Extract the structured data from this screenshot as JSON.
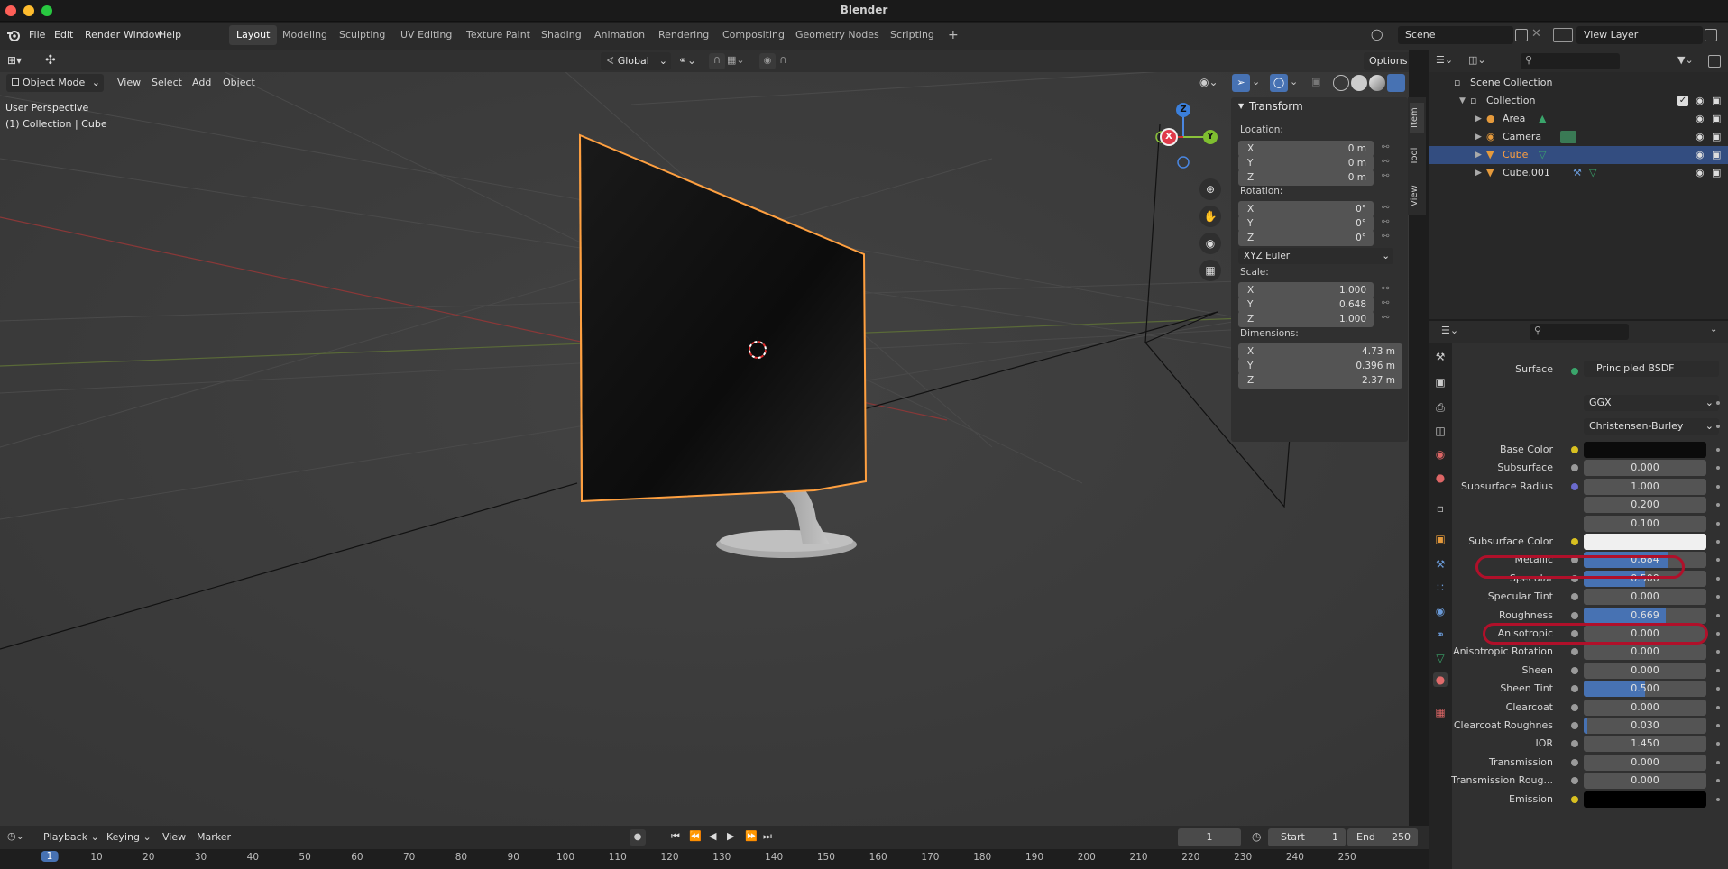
{
  "window": {
    "title": "Blender"
  },
  "menu": [
    "File",
    "Edit",
    "Render",
    "Window",
    "Help"
  ],
  "workspaces": [
    {
      "label": "Layout",
      "active": true
    },
    {
      "label": "Modeling"
    },
    {
      "label": "Sculpting"
    },
    {
      "label": "UV Editing"
    },
    {
      "label": "Texture Paint"
    },
    {
      "label": "Shading"
    },
    {
      "label": "Animation"
    },
    {
      "label": "Rendering"
    },
    {
      "label": "Compositing"
    },
    {
      "label": "Geometry Nodes"
    },
    {
      "label": "Scripting"
    }
  ],
  "add_workspace": "+",
  "scene": {
    "name": "Scene",
    "view_layer": "View Layer"
  },
  "viewport": {
    "transform_orientation": "Global",
    "options_label": "Options",
    "mode": "Object Mode",
    "menus": [
      "View",
      "Select",
      "Add",
      "Object"
    ],
    "overlay_text": {
      "perspective": "User Perspective",
      "context": "(1) Collection | Cube"
    },
    "gizmo": {
      "x": "X",
      "y": "Y",
      "z": "Z"
    }
  },
  "npanel": {
    "header": "Transform",
    "tabs": [
      "Item",
      "Tool",
      "View"
    ],
    "location_label": "Location:",
    "location": [
      {
        "axis": "X",
        "value": "0 m"
      },
      {
        "axis": "Y",
        "value": "0 m"
      },
      {
        "axis": "Z",
        "value": "0 m"
      }
    ],
    "rotation_label": "Rotation:",
    "rotation": [
      {
        "axis": "X",
        "value": "0°"
      },
      {
        "axis": "Y",
        "value": "0°"
      },
      {
        "axis": "Z",
        "value": "0°"
      }
    ],
    "rotation_mode": "XYZ Euler",
    "scale_label": "Scale:",
    "scale": [
      {
        "axis": "X",
        "value": "1.000"
      },
      {
        "axis": "Y",
        "value": "0.648"
      },
      {
        "axis": "Z",
        "value": "1.000"
      }
    ],
    "dimensions_label": "Dimensions:",
    "dimensions": [
      {
        "axis": "X",
        "value": "4.73 m"
      },
      {
        "axis": "Y",
        "value": "0.396 m"
      },
      {
        "axis": "Z",
        "value": "2.37 m"
      }
    ]
  },
  "outliner": {
    "rows": [
      {
        "label": "Scene Collection"
      },
      {
        "label": "Collection"
      },
      {
        "label": "Area"
      },
      {
        "label": "Camera"
      },
      {
        "label": "Cube",
        "selected": true
      },
      {
        "label": "Cube.001"
      }
    ]
  },
  "properties": {
    "surface_label": "Surface",
    "surface_value": "Principled BSDF",
    "distribution": "GGX",
    "subsurface_method": "Christensen-Burley",
    "rows": [
      {
        "label": "Base Color",
        "value": "",
        "dot": "#d8c020",
        "color": "#0b0b0b"
      },
      {
        "label": "Subsurface",
        "value": "0.000",
        "fill": 0
      },
      {
        "label": "Subsurface Radius",
        "value": "1.000",
        "fill": 0,
        "dot": "#6a6acc"
      },
      {
        "label": "",
        "value": "0.200",
        "fill": 0,
        "nodot": true
      },
      {
        "label": "",
        "value": "0.100",
        "fill": 0,
        "nodot": true
      },
      {
        "label": "Subsurface Color",
        "value": "",
        "dot": "#d8c020",
        "color": "#f0f0f0"
      },
      {
        "label": "Metallic",
        "value": "0.684",
        "fill": 0.684,
        "highlight": true
      },
      {
        "label": "Specular",
        "value": "0.500",
        "fill": 0.5
      },
      {
        "label": "Specular Tint",
        "value": "0.000",
        "fill": 0
      },
      {
        "label": "Roughness",
        "value": "0.669",
        "fill": 0.669,
        "highlight": true
      },
      {
        "label": "Anisotropic",
        "value": "0.000",
        "fill": 0
      },
      {
        "label": "Anisotropic Rotation",
        "value": "0.000",
        "fill": 0
      },
      {
        "label": "Sheen",
        "value": "0.000",
        "fill": 0
      },
      {
        "label": "Sheen Tint",
        "value": "0.500",
        "fill": 0.5
      },
      {
        "label": "Clearcoat",
        "value": "0.000",
        "fill": 0
      },
      {
        "label": "Clearcoat Roughnes",
        "value": "0.030",
        "fill": 0.03
      },
      {
        "label": "IOR",
        "value": "1.450",
        "fill": 0
      },
      {
        "label": "Transmission",
        "value": "0.000",
        "fill": 0
      },
      {
        "label": "Transmission Roug...",
        "value": "0.000",
        "fill": 0
      },
      {
        "label": "Emission",
        "value": "",
        "dot": "#d8c020",
        "color": "#000000"
      }
    ]
  },
  "timeline": {
    "menus": [
      "Playback",
      "Keying",
      "View",
      "Marker"
    ],
    "current_frame": "1",
    "start_label": "Start",
    "start": "1",
    "end_label": "End",
    "end": "250",
    "ticks": [
      "1",
      "10",
      "20",
      "30",
      "40",
      "50",
      "60",
      "70",
      "80",
      "90",
      "100",
      "110",
      "120",
      "130",
      "140",
      "150",
      "160",
      "170",
      "180",
      "190",
      "200",
      "210",
      "220",
      "230",
      "240",
      "250"
    ]
  },
  "colors": {
    "accent": "#4772b3",
    "selection_outline": "#ffa040",
    "highlight_ring": "#b0102a"
  }
}
